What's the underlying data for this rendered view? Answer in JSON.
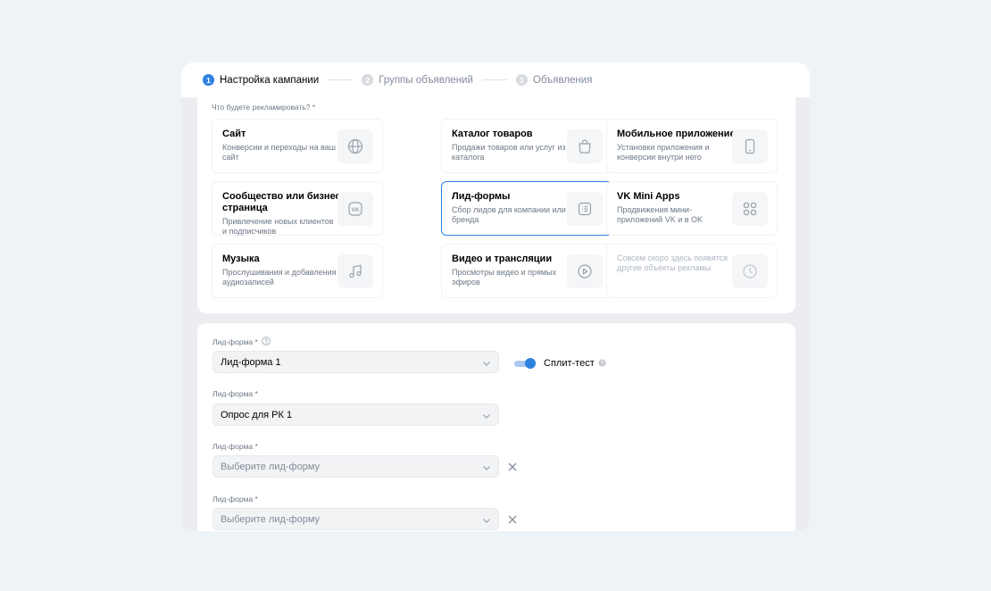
{
  "stepper": {
    "steps": [
      {
        "num": "1",
        "label": "Настройка кампании"
      },
      {
        "num": "2",
        "label": "Группы объявлений"
      },
      {
        "num": "3",
        "label": "Объявления"
      }
    ]
  },
  "objective": {
    "label": "Что будете рекламировать? *",
    "cards": [
      {
        "title": "Сайт",
        "desc": "Конверсии и переходы на ваш сайт",
        "icon": "globe-icon"
      },
      {
        "title": "Каталог товаров",
        "desc": "Продажи товаров или услуг из каталога",
        "icon": "shopping-bag-icon"
      },
      {
        "title": "Мобильное приложение",
        "desc": "Установки приложения и конверсии внутри него",
        "icon": "smartphone-icon"
      },
      {
        "title": "Сообщество или бизнес-страница",
        "desc": "Привлечение новых клиентов и подписчиков",
        "icon": "vk-logo-icon"
      },
      {
        "title": "Лид-формы",
        "desc": "Сбор лидов для компании или бренда",
        "icon": "form-list-icon"
      },
      {
        "title": "VK Mini Apps",
        "desc": "Продвижения мини-приложений VK и в OK",
        "icon": "apps-grid-icon"
      },
      {
        "title": "Музыка",
        "desc": "Прослушивания и добавления аудиозаписей",
        "icon": "music-note-icon"
      },
      {
        "title": "Видео и трансляции",
        "desc": "Просмотры видео и прямых эфиров",
        "icon": "play-circle-icon"
      },
      {
        "title": "",
        "desc": "Совсем скоро здесь появятся другие объекты рекламы",
        "icon": "clock-icon"
      }
    ],
    "selected": "Лид-формы"
  },
  "leadforms": {
    "fields": [
      {
        "label": "Лид-форма *",
        "value": "Лид-форма 1"
      },
      {
        "label": "Лид-форма *",
        "value": "Опрос для РК 1"
      },
      {
        "label": "Лид-форма *",
        "value": "Выберите лид-форму"
      },
      {
        "label": "Лид-форма *",
        "value": "Выберите лид-форму"
      }
    ],
    "split_test_label": "Сплит-тест",
    "split_test_on": true
  },
  "colors": {
    "accent": "#2d81e0",
    "background": "#eef3f8"
  }
}
